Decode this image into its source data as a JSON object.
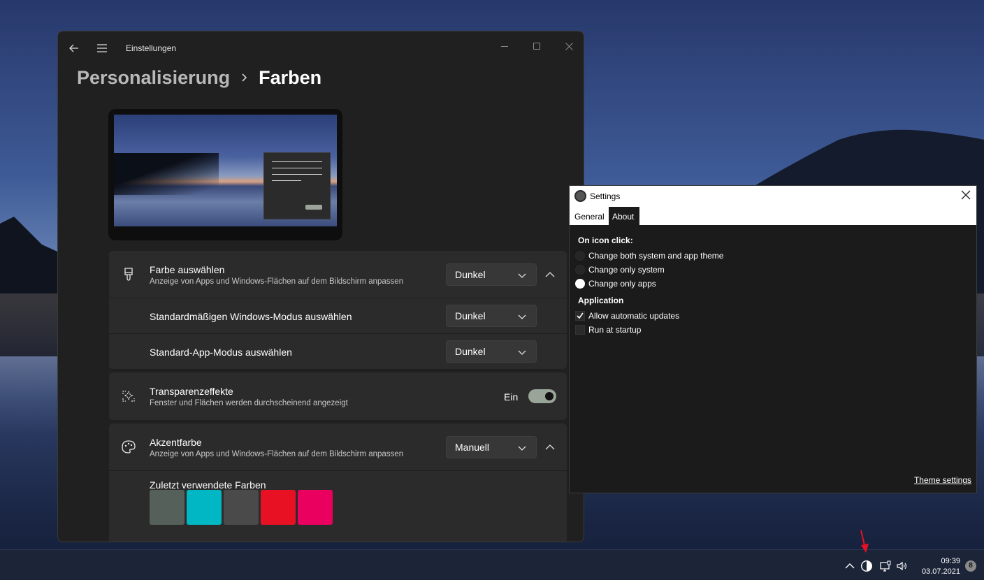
{
  "settings_window": {
    "app_title": "Einstellungen",
    "breadcrumb_parent": "Personalisierung",
    "breadcrumb_current": "Farben",
    "color_mode": {
      "title": "Farbe auswählen",
      "subtitle": "Anzeige von Apps und Windows-Flächen auf dem Bildschirm anpassen",
      "value": "Dunkel"
    },
    "windows_mode": {
      "title": "Standardmäßigen Windows-Modus auswählen",
      "value": "Dunkel"
    },
    "app_mode": {
      "title": "Standard-App-Modus auswählen",
      "value": "Dunkel"
    },
    "transparency": {
      "title": "Transparenzeffekte",
      "subtitle": "Fenster und Flächen werden durchscheinend angezeigt",
      "state_label": "Ein"
    },
    "accent": {
      "title": "Akzentfarbe",
      "subtitle": "Anzeige von Apps und Windows-Flächen auf dem Bildschirm anpassen",
      "value": "Manuell",
      "recent_label": "Zuletzt verwendete Farben",
      "recent_colors": [
        "#56605a",
        "#00b7c3",
        "#4a4a4a",
        "#e81123",
        "#ea005e"
      ]
    }
  },
  "app_window": {
    "title": "Settings",
    "tabs": [
      "General",
      "About"
    ],
    "on_icon_click_heading": "On icon click:",
    "options": [
      {
        "label": "Change both system and app theme",
        "selected": false
      },
      {
        "label": "Change only system",
        "selected": false
      },
      {
        "label": "Change only apps",
        "selected": true
      }
    ],
    "application_heading": "Application",
    "checkboxes": [
      {
        "label": "Allow automatic updates",
        "checked": true
      },
      {
        "label": "Run at startup",
        "checked": false
      }
    ],
    "theme_settings_link": "Theme settings"
  },
  "taskbar": {
    "time": "09:39",
    "date": "03.07.2021",
    "notification_count": "8"
  },
  "colors": {
    "window_bg": "#202020",
    "card_bg": "#2b2b2b",
    "toggle_on": "#9aa59a",
    "annotation_arrow": "#e81123"
  }
}
